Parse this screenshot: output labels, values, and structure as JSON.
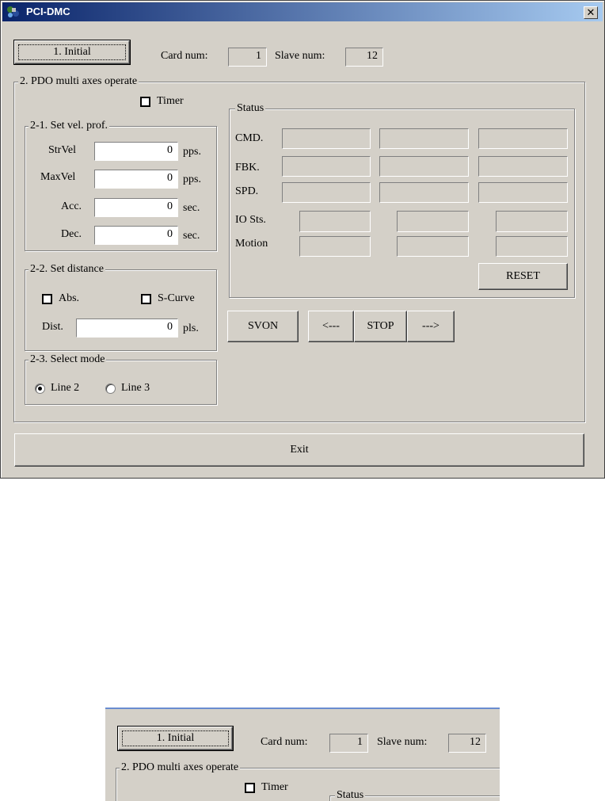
{
  "window": {
    "title": "PCI-DMC",
    "close_label": "✕"
  },
  "top": {
    "initial_label": "1. Initial",
    "card_num_label": "Card num:",
    "card_num_value": "1",
    "slave_num_label": "Slave num:",
    "slave_num_value": "12"
  },
  "pdo": {
    "group_label": "2. PDO multi axes operate",
    "timer_label": "Timer"
  },
  "velocity": {
    "group_label": "2-1. Set vel. prof.",
    "rows": [
      {
        "label": "StrVel",
        "value": "0",
        "unit": "pps."
      },
      {
        "label": "MaxVel",
        "value": "0",
        "unit": "pps."
      },
      {
        "label": "Acc.",
        "value": "0",
        "unit": "sec."
      },
      {
        "label": "Dec.",
        "value": "0",
        "unit": "sec."
      }
    ]
  },
  "distance": {
    "group_label": "2-2. Set distance",
    "abs_label": "Abs.",
    "scurve_label": "S-Curve",
    "dist_label": "Dist.",
    "dist_value": "0",
    "dist_unit": "pls."
  },
  "mode": {
    "group_label": "2-3. Select mode",
    "line2_label": "Line 2",
    "line3_label": "Line 3",
    "selected": "Line 2"
  },
  "status": {
    "group_label": "Status",
    "cmd_label": "CMD.",
    "fbk_label": "FBK.",
    "spd_label": "SPD.",
    "io_label": "IO Sts.",
    "motion_label": "Motion",
    "reset_label": "RESET"
  },
  "motion_buttons": {
    "svon_label": "SVON",
    "left_label": "<---",
    "stop_label": "STOP",
    "right_label": "--->"
  },
  "exit_label": "Exit"
}
